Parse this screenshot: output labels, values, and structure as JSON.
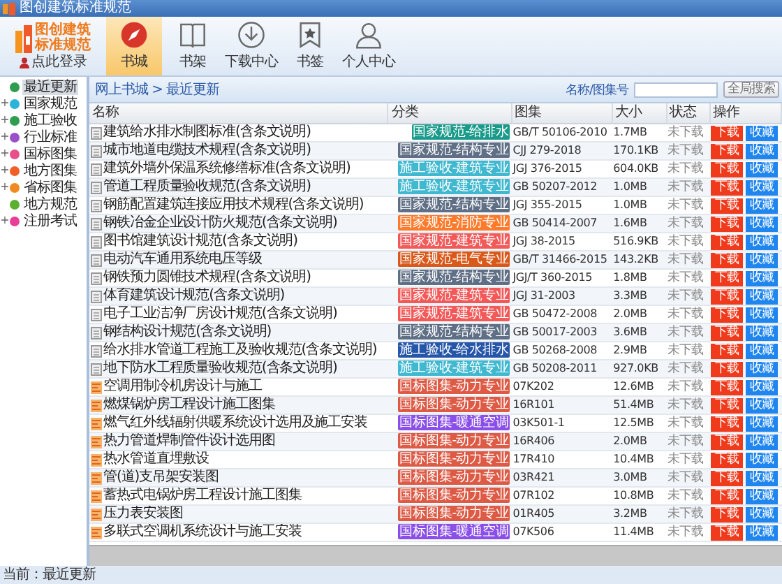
{
  "window": {
    "title": "图创建筑标准规范"
  },
  "logo": {
    "line1": "图创建筑",
    "line2": "标准规范"
  },
  "login": "点此登录",
  "nav": [
    {
      "label": "书城",
      "kind": "compass",
      "selected": true
    },
    {
      "label": "书架",
      "kind": "book",
      "selected": false
    },
    {
      "label": "下载中心",
      "kind": "download",
      "selected": false
    },
    {
      "label": "书签",
      "kind": "bookmark",
      "selected": false
    },
    {
      "label": "个人中心",
      "kind": "person",
      "selected": false
    }
  ],
  "sidebar": {
    "items": [
      {
        "label": "最近更新",
        "kind": "leaf",
        "color": "#2e9e4e",
        "selected": true
      },
      {
        "label": "国家规范",
        "kind": "folder",
        "toggle": "+",
        "color": "#2bb3d9",
        "selected": false
      },
      {
        "label": "施工验收",
        "kind": "folder",
        "toggle": "+",
        "color": "#2e9e4e",
        "selected": false
      },
      {
        "label": "行业标准",
        "kind": "folder",
        "toggle": "+",
        "color": "#9b4fc9",
        "selected": false
      },
      {
        "label": "国标图集",
        "kind": "folder",
        "toggle": "+",
        "color": "#e8508a",
        "selected": false
      },
      {
        "label": "地方图集",
        "kind": "folder",
        "toggle": "+",
        "color": "#f0602a",
        "selected": false
      },
      {
        "label": "省标图集",
        "kind": "folder",
        "toggle": "+",
        "color": "#f08a20",
        "selected": false
      },
      {
        "label": "地方规范",
        "kind": "leaf",
        "color": "#5cb030",
        "selected": false
      },
      {
        "label": "注册考试",
        "kind": "folder",
        "toggle": "+",
        "color": "#e83e9a",
        "selected": false
      }
    ]
  },
  "breadcrumb": "网上书城 > 最近更新",
  "search": {
    "label": "名称/图集号",
    "button": "全局搜索"
  },
  "table": {
    "columns": [
      "名称",
      "分类",
      "图集",
      "大小",
      "状态",
      "操作"
    ],
    "rows": [
      {
        "kind": "standard",
        "name": "建筑给水排水制图标准(含条文说明)",
        "category": "国家规范-给排水",
        "color": "#1a9a8a",
        "code": "GB/T 50106-2010",
        "size": "1.7MB",
        "status": "未下载",
        "download": "下载",
        "favorite": "收藏"
      },
      {
        "kind": "standard",
        "name": "城市地道电缆技术规程(含条文说明)",
        "category": "国家规范-结构专业",
        "color": "#5f6f85",
        "code": "CJJ 279-2018",
        "size": "170.1KB",
        "status": "未下载",
        "download": "下载",
        "favorite": "收藏"
      },
      {
        "kind": "standard",
        "name": "建筑外墙外保温系统修缮标准(含条文说明)",
        "category": "施工验收-建筑专业",
        "color": "#3fb8d0",
        "code": "JGJ 376-2015",
        "size": "604.0KB",
        "status": "未下载",
        "download": "下载",
        "favorite": "收藏"
      },
      {
        "kind": "standard",
        "name": "管道工程质量验收规范(含条文说明)",
        "category": "施工验收-建筑专业",
        "color": "#3fb8d0",
        "code": "GB 50207-2012",
        "size": "1.0MB",
        "status": "未下载",
        "download": "下载",
        "favorite": "收藏"
      },
      {
        "kind": "standard",
        "name": "钢筋配置建筑连接应用技术规程(含条文说明)",
        "category": "国家规范-结构专业",
        "color": "#5f6f85",
        "code": "JGJ 355-2015",
        "size": "1.0MB",
        "status": "未下载",
        "download": "下载",
        "favorite": "收藏"
      },
      {
        "kind": "standard",
        "name": "钢铁冶金企业设计防火规范(含条文说明)",
        "category": "国家规范-消防专业",
        "color": "#ff7a2a",
        "code": "GB 50414-2007",
        "size": "1.6MB",
        "status": "未下载",
        "download": "下载",
        "favorite": "收藏"
      },
      {
        "kind": "standard",
        "name": "图书馆建筑设计规范(含条文说明)",
        "category": "国家规范-建筑专业",
        "color": "#f25a5a",
        "code": "JGJ 38-2015",
        "size": "516.9KB",
        "status": "未下载",
        "download": "下载",
        "favorite": "收藏"
      },
      {
        "kind": "standard",
        "name": "电动汽车通用系统电压等级",
        "category": "国家规范-电气专业",
        "color": "#d9591b",
        "code": "GB/T 31466-2015",
        "size": "143.2KB",
        "status": "未下载",
        "download": "下载",
        "favorite": "收藏"
      },
      {
        "kind": "standard",
        "name": "钢铁预力圆锥技术规程(含条文说明)",
        "category": "国家规范-结构专业",
        "color": "#5f6f85",
        "code": "JGJ/T 360-2015",
        "size": "1.8MB",
        "status": "未下载",
        "download": "下载",
        "favorite": "收藏"
      },
      {
        "kind": "standard",
        "name": "体育建筑设计规范(含条文说明)",
        "category": "国家规范-建筑专业",
        "color": "#f25a5a",
        "code": "JGJ 31-2003",
        "size": "3.3MB",
        "status": "未下载",
        "download": "下载",
        "favorite": "收藏"
      },
      {
        "kind": "standard",
        "name": "电子工业洁净厂房设计规范(含条文说明)",
        "category": "国家规范-建筑专业",
        "color": "#f25a5a",
        "code": "GB 50472-2008",
        "size": "2.0MB",
        "status": "未下载",
        "download": "下载",
        "favorite": "收藏"
      },
      {
        "kind": "standard",
        "name": "钢结构设计规范(含条文说明)",
        "category": "国家规范-结构专业",
        "color": "#5f6f85",
        "code": "GB 50017-2003",
        "size": "3.6MB",
        "status": "未下载",
        "download": "下载",
        "favorite": "收藏"
      },
      {
        "kind": "standard",
        "name": "给水排水管道工程施工及验收规范(含条文说明)",
        "category": "施工验收-给水排水",
        "color": "#2656a8",
        "code": "GB 50268-2008",
        "size": "2.9MB",
        "status": "未下载",
        "download": "下载",
        "favorite": "收藏"
      },
      {
        "kind": "standard",
        "name": "地下防水工程质量验收规范(含条文说明)",
        "category": "施工验收-建筑专业",
        "color": "#3fb8d0",
        "code": "GB 50208-2011",
        "size": "927.0KB",
        "status": "未下载",
        "download": "下载",
        "favorite": "收藏"
      },
      {
        "kind": "atlas",
        "name": "空调用制冷机房设计与施工",
        "category": "国标图集-动力专业",
        "color": "#dd5a45",
        "code": "07K202",
        "size": "12.6MB",
        "status": "未下载",
        "download": "下载",
        "favorite": "收藏"
      },
      {
        "kind": "atlas",
        "name": "燃煤锅炉房工程设计施工图集",
        "category": "国标图集-动力专业",
        "color": "#dd5a45",
        "code": "16R101",
        "size": "51.4MB",
        "status": "未下载",
        "download": "下载",
        "favorite": "收藏"
      },
      {
        "kind": "atlas",
        "name": "燃气红外线辐射供暖系统设计选用及施工安装",
        "category": "国标图集-暖通空调",
        "color": "#8a4fe8",
        "code": "03K501-1",
        "size": "12.5MB",
        "status": "未下载",
        "download": "下载",
        "favorite": "收藏"
      },
      {
        "kind": "atlas",
        "name": "热力管道焊制管件设计选用图",
        "category": "国标图集-动力专业",
        "color": "#dd5a45",
        "code": "16R406",
        "size": "2.0MB",
        "status": "未下载",
        "download": "下载",
        "favorite": "收藏"
      },
      {
        "kind": "atlas",
        "name": "热水管道直埋敷设",
        "category": "国标图集-动力专业",
        "color": "#dd5a45",
        "code": "17R410",
        "size": "10.4MB",
        "status": "未下载",
        "download": "下载",
        "favorite": "收藏"
      },
      {
        "kind": "atlas",
        "name": "管(道)支吊架安装图",
        "category": "国标图集-动力专业",
        "color": "#dd5a45",
        "code": "03R421",
        "size": "3.0MB",
        "status": "未下载",
        "download": "下载",
        "favorite": "收藏"
      },
      {
        "kind": "atlas",
        "name": "蓄热式电锅炉房工程设计施工图集",
        "category": "国标图集-动力专业",
        "color": "#dd5a45",
        "code": "07R102",
        "size": "10.8MB",
        "status": "未下载",
        "download": "下载",
        "favorite": "收藏"
      },
      {
        "kind": "atlas",
        "name": "压力表安装图",
        "category": "国标图集-动力专业",
        "color": "#dd5a45",
        "code": "01R405",
        "size": "3.2MB",
        "status": "未下载",
        "download": "下载",
        "favorite": "收藏"
      },
      {
        "kind": "atlas",
        "name": "多联式空调机系统设计与施工安装",
        "category": "国标图集-暖通空调",
        "color": "#8a4fe8",
        "code": "07K506",
        "size": "11.4MB",
        "status": "未下载",
        "download": "下载",
        "favorite": "收藏"
      }
    ]
  },
  "status_bar": "当前：最近更新"
}
